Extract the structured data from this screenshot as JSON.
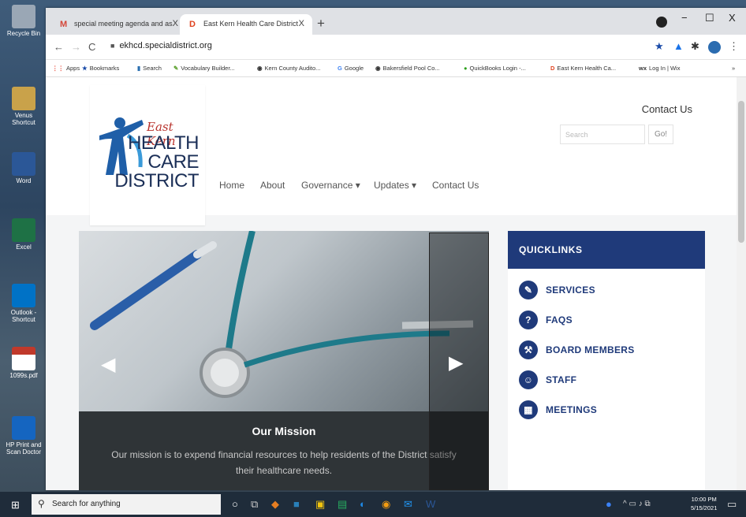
{
  "desktop": {
    "icons": [
      {
        "label": "Recycle Bin",
        "color": "#9aa7b5"
      },
      {
        "label": "Venus Shortcut",
        "color": "#c9a24a"
      },
      {
        "label": "Word",
        "color": "#2b5797"
      },
      {
        "label": "Excel",
        "color": "#1e7145"
      },
      {
        "label": "Outlook - Shortcut",
        "color": "#0072c6"
      },
      {
        "label": "1099s.pdf",
        "color": "#c0392b"
      },
      {
        "label": "HP Print and Scan Doctor",
        "color": "#1565c0"
      }
    ]
  },
  "browser": {
    "tabs": [
      {
        "icon": "M",
        "label": "special meeting agenda and as",
        "close": "X"
      },
      {
        "icon": "D",
        "label": "East Kern Health Care District",
        "close": "X"
      }
    ],
    "new_tab": "+",
    "url": "ekhcd.specialdistrict.org",
    "window_controls": {
      "minimize": "−",
      "maximize": "☐",
      "close": "X"
    },
    "bookmarks": [
      "Apps",
      "Bookmarks",
      "Search",
      "Vocabulary Builder...",
      "Kern County Audito...",
      "Google",
      "Bakersfield Pool Co...",
      "QuickBooks Login -...",
      "East Kern Health Ca...",
      "Log In | Wix"
    ]
  },
  "site": {
    "logo": {
      "top": "East Kern",
      "l1": "HEALTH",
      "l2": "CARE",
      "l3": "DISTRICT"
    },
    "contact_top": "Contact Us",
    "search_placeholder": "Search",
    "go": "Go!",
    "nav": [
      "Home",
      "About",
      "Governance ▾",
      "Updates ▾",
      "Contact Us"
    ],
    "slide": {
      "title": "Our Mission",
      "text": "Our mission is to expend financial resources to help residents of the District satisfy their healthcare needs."
    },
    "quicklinks": {
      "heading": "QUICKLINKS",
      "items": [
        "SERVICES",
        "FAQS",
        "BOARD MEMBERS",
        "STAFF",
        "MEETINGS"
      ]
    }
  },
  "taskbar": {
    "search": "Search for anything",
    "time": "10:00 PM",
    "date": "5/15/2021"
  }
}
